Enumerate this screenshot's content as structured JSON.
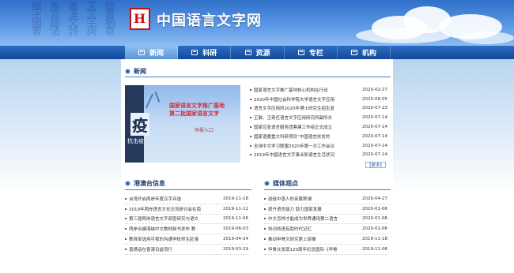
{
  "site": {
    "logo_char": "H",
    "title": "中国语言文字网"
  },
  "nav": [
    {
      "label": "新闻",
      "active": true
    },
    {
      "label": "科研",
      "active": false
    },
    {
      "label": "资源",
      "active": false
    },
    {
      "label": "专栏",
      "active": false
    },
    {
      "label": "机构",
      "active": false
    }
  ],
  "news": {
    "heading": "新闻",
    "image": {
      "big_char": "疫",
      "side_text": "抗击疫",
      "line1": "国家语言文字推广基地",
      "line2": "第二批国家语言文字",
      "line3": "申报入口"
    },
    "items": [
      {
        "text": "国家语言文字推广基地核心机构在行动",
        "date": "2020-02-27"
      },
      {
        "text": "2020年中国社会科学院大学语言文字应用",
        "date": "2020-08-05"
      },
      {
        "text": "语言文字应用所2020年博士研究生招生复",
        "date": "2020-07-23"
      },
      {
        "text": "王敏、王奇任语言文字应用研究所副所长",
        "date": "2020-07-14"
      },
      {
        "text": "国家应急语言服务团筹建工作组正式成立",
        "date": "2020-07-14"
      },
      {
        "text": "国家语委重大科研项目“中国语言扶贫的",
        "date": "2020-07-14"
      },
      {
        "text": "全球中文学习联盟2020年第一次工作会议",
        "date": "2020-07-14"
      },
      {
        "text": "2019年中国语言文字事业和语言生活状况",
        "date": "2020-07-14"
      }
    ],
    "more_label": "【更多】"
  },
  "hk": {
    "heading": "港澳台信息",
    "items": [
      {
        "text": "台湾开启两岸年度汉字评选",
        "date": "2019-11-18"
      },
      {
        "text": "2019年两岸语言文化交流研讨会在南",
        "date": "2019-11-12"
      },
      {
        "text": "第三届两岸语言文字调查研究与语文",
        "date": "2019-11-06"
      },
      {
        "text": "两岸合编海峡中文教材新书发布 教",
        "date": "2019-06-03"
      },
      {
        "text": "教育部选用可视的沟通学校师生赴港",
        "date": "2019-04-24"
      },
      {
        "text": "普通话在香港日益流行",
        "date": "2019-03-29"
      }
    ]
  },
  "media": {
    "heading": "媒体观点",
    "items": [
      {
        "text": "战役中感人的亲属称谓",
        "date": "2020-04-27"
      },
      {
        "text": "提升语言能力 助力国家发展",
        "date": "2020-01-06"
      },
      {
        "text": "中文怎样才能成为世界通用第二语言",
        "date": "2020-01-06"
      },
      {
        "text": "热词热语有助时代记忆",
        "date": "2020-01-06"
      },
      {
        "text": "推动甲骨文研究更上层楼",
        "date": "2019-11-18"
      },
      {
        "text": "甲骨文发现120周年纪念国际《甲骨",
        "date": "2019-11-06"
      }
    ]
  }
}
